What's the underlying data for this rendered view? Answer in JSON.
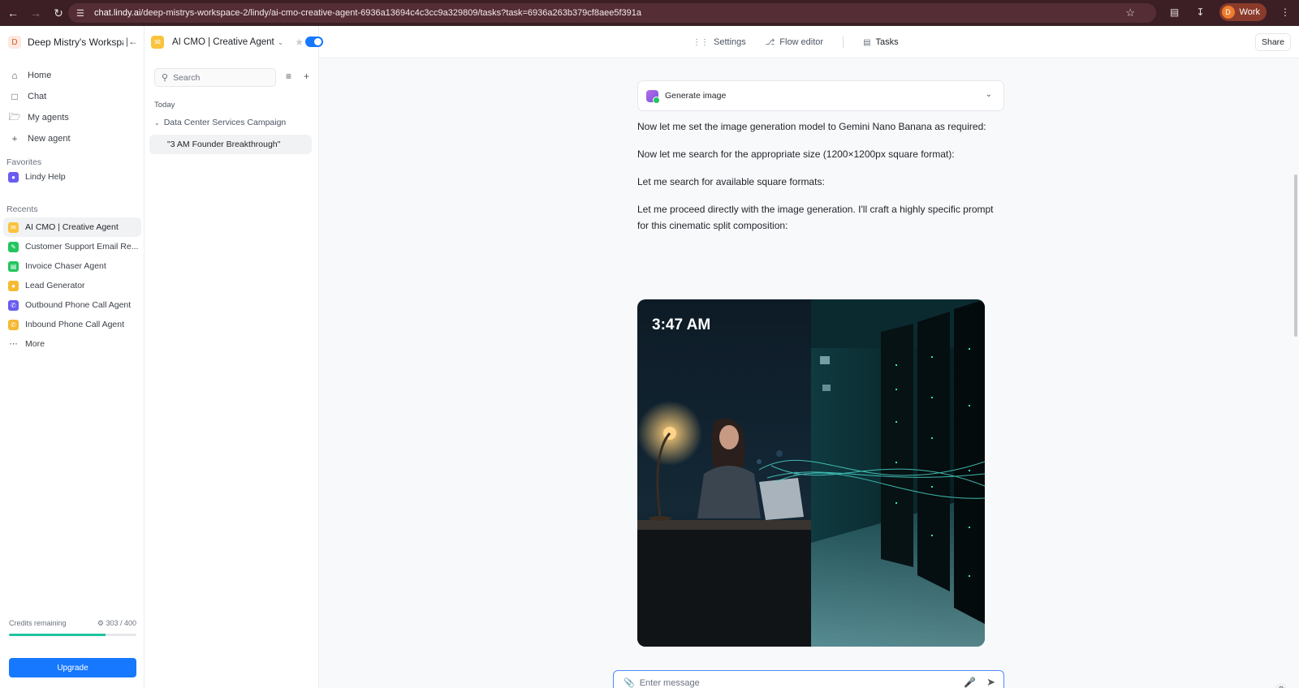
{
  "browser": {
    "url_host": "chat.lindy.ai",
    "url_path": "/deep-mistrys-workspace-2/lindy/ai-cmo-creative-agent-6936a13694c4c3cc9a329809/tasks?task=6936a263b379cf8aee5f391a",
    "profile_initial": "D",
    "profile_label": "Work"
  },
  "workspace": {
    "initial": "D",
    "name": "Deep Mistry's Workspace"
  },
  "nav": [
    {
      "label": "Home",
      "icon": "home-icon"
    },
    {
      "label": "Chat",
      "icon": "chat-icon"
    },
    {
      "label": "My agents",
      "icon": "folder-icon"
    },
    {
      "label": "New agent",
      "icon": "plus-icon"
    }
  ],
  "favorites": {
    "label": "Favorites",
    "items": [
      {
        "label": "Lindy Help",
        "color": "#6a5cf0"
      }
    ]
  },
  "recents": {
    "label": "Recents",
    "items": [
      {
        "label": "AI CMO | Creative Agent",
        "color": "#f9c33c",
        "active": true
      },
      {
        "label": "Customer Support Email Re...",
        "color": "#22c55e"
      },
      {
        "label": "Invoice Chaser Agent",
        "color": "#22c55e"
      },
      {
        "label": "Lead Generator",
        "color": "#f5b932"
      },
      {
        "label": "Outbound Phone Call Agent",
        "color": "#6a5cf0"
      },
      {
        "label": "Inbound Phone Call Agent",
        "color": "#f5b932"
      }
    ],
    "more": "More"
  },
  "credits": {
    "label": "Credits remaining",
    "value": "303 / 400",
    "fraction": 0.7575
  },
  "upgrade_label": "Upgrade",
  "agent": {
    "name": "AI CMO | Creative Agent",
    "enabled": true
  },
  "taskpanel": {
    "search_placeholder": "Search",
    "group_date": "Today",
    "group_name": "Data Center Services Campaign",
    "task_title": "\"3 AM Founder Breakthrough\""
  },
  "tabs": [
    {
      "label": "Settings",
      "icon": "sliders-icon"
    },
    {
      "label": "Flow editor",
      "icon": "flow-icon"
    },
    {
      "label": "Tasks",
      "icon": "document-icon",
      "active": true
    }
  ],
  "share_label": "Share",
  "conversation": {
    "tool_label": "Generate image",
    "messages": [
      "Now let me set the image generation model to Gemini Nano Banana as required:",
      "Now let me search for the appropriate size (1200×1200px square format):",
      "Let me search for available square formats:",
      "Let me proceed directly with the image generation. I'll craft a highly specific prompt for this cinematic split composition:"
    ],
    "image_time_text": "3:47 AM"
  },
  "composer": {
    "placeholder": "Enter message"
  },
  "help_label": "?"
}
